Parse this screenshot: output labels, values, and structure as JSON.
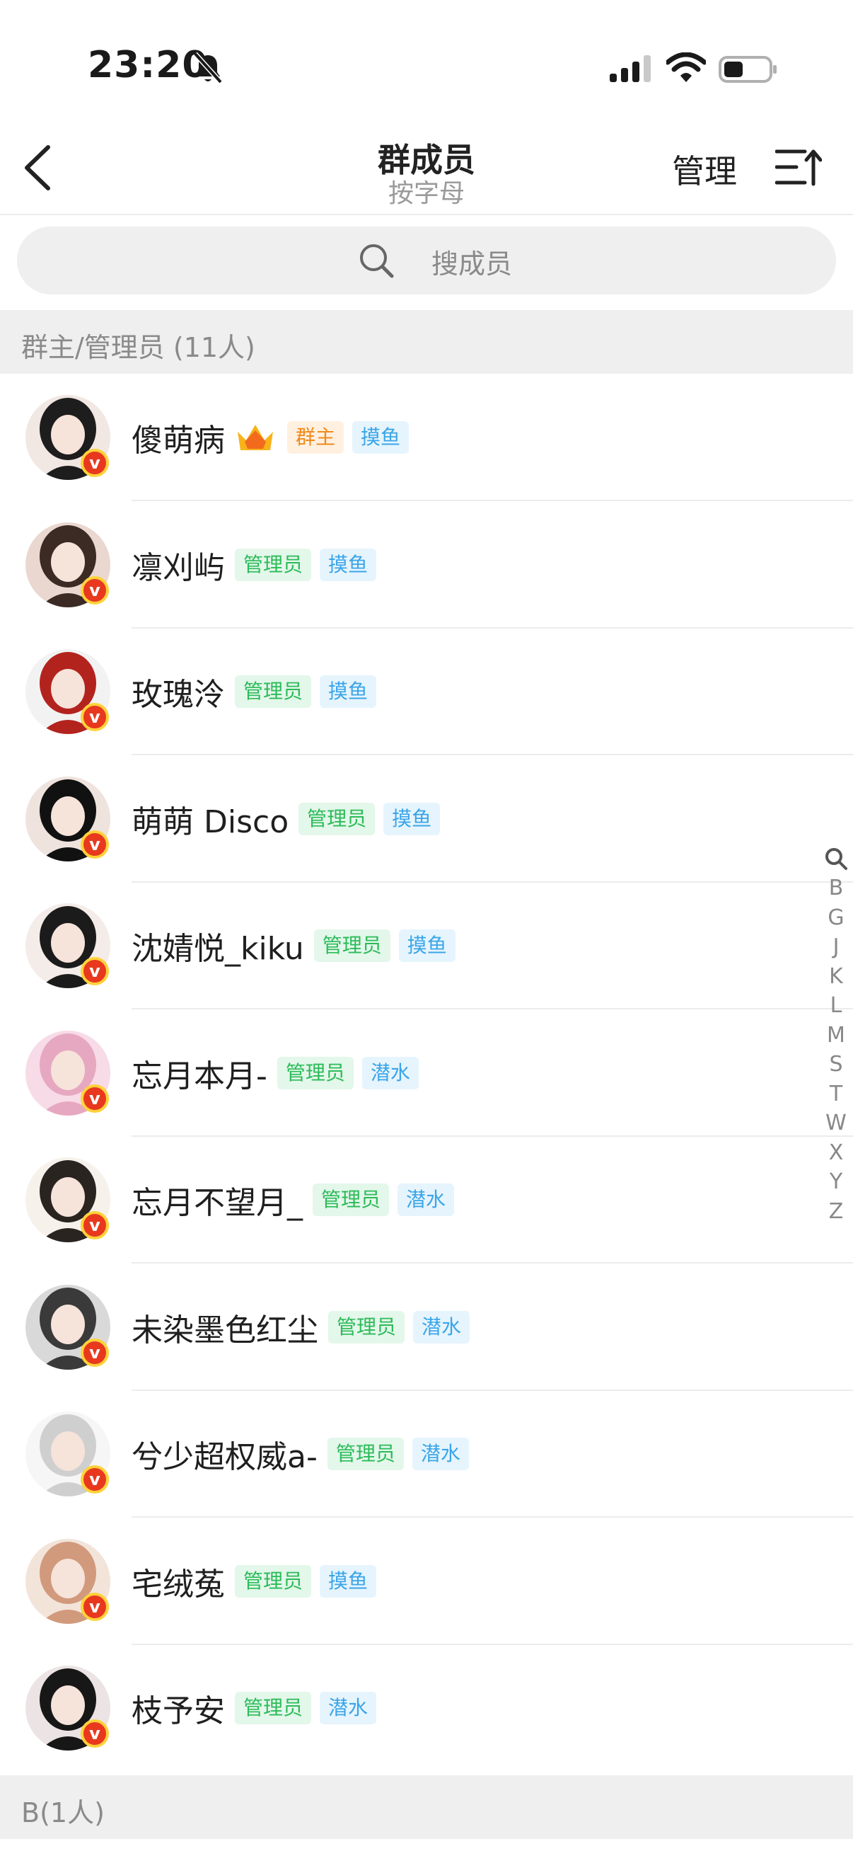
{
  "status_bar": {
    "time": "23:20"
  },
  "header": {
    "title": "群成员",
    "subtitle": "按字母",
    "manage_label": "管理"
  },
  "search": {
    "placeholder": "搜成员"
  },
  "sections": [
    {
      "title": "群主/管理员 (11人)"
    },
    {
      "title": "B(1人)"
    }
  ],
  "members": [
    {
      "name": "傻萌病",
      "crown": true,
      "tags": [
        {
          "text": "群主",
          "kind": "owner"
        },
        {
          "text": "摸鱼",
          "kind": "level"
        }
      ],
      "avatar_colors": [
        "#f1e7e3",
        "#1d1d1d"
      ]
    },
    {
      "name": "凛刈屿",
      "crown": false,
      "tags": [
        {
          "text": "管理员",
          "kind": "admin"
        },
        {
          "text": "摸鱼",
          "kind": "level"
        }
      ],
      "avatar_colors": [
        "#ead7cf",
        "#3b2b24"
      ]
    },
    {
      "name": "玫瑰泠",
      "crown": false,
      "tags": [
        {
          "text": "管理员",
          "kind": "admin"
        },
        {
          "text": "摸鱼",
          "kind": "level"
        }
      ],
      "avatar_colors": [
        "#f2f2f2",
        "#b3231e"
      ]
    },
    {
      "name": "萌萌 Disco",
      "crown": false,
      "tags": [
        {
          "text": "管理员",
          "kind": "admin"
        },
        {
          "text": "摸鱼",
          "kind": "level"
        }
      ],
      "avatar_colors": [
        "#efe3de",
        "#111111"
      ]
    },
    {
      "name": "沈婧悦_kiku",
      "crown": false,
      "tags": [
        {
          "text": "管理员",
          "kind": "admin"
        },
        {
          "text": "摸鱼",
          "kind": "level"
        }
      ],
      "avatar_colors": [
        "#f4ece8",
        "#1b1b1b"
      ]
    },
    {
      "name": "忘月本月-",
      "crown": false,
      "tags": [
        {
          "text": "管理员",
          "kind": "admin"
        },
        {
          "text": "潜水",
          "kind": "level"
        }
      ],
      "avatar_colors": [
        "#f7dbe6",
        "#e6a8c0"
      ]
    },
    {
      "name": "忘月不望月_",
      "crown": false,
      "tags": [
        {
          "text": "管理员",
          "kind": "admin"
        },
        {
          "text": "潜水",
          "kind": "level"
        }
      ],
      "avatar_colors": [
        "#f6f1ea",
        "#2a2421"
      ]
    },
    {
      "name": "未染墨色红尘",
      "crown": false,
      "tags": [
        {
          "text": "管理员",
          "kind": "admin"
        },
        {
          "text": "潜水",
          "kind": "level"
        }
      ],
      "avatar_colors": [
        "#d9d9d9",
        "#3a3a3a"
      ]
    },
    {
      "name": "兮少超权威a-",
      "crown": false,
      "tags": [
        {
          "text": "管理员",
          "kind": "admin"
        },
        {
          "text": "潜水",
          "kind": "level"
        }
      ],
      "avatar_colors": [
        "#f6f6f6",
        "#cfcfcf"
      ]
    },
    {
      "name": "宅绒菟",
      "crown": false,
      "tags": [
        {
          "text": "管理员",
          "kind": "admin"
        },
        {
          "text": "摸鱼",
          "kind": "level"
        }
      ],
      "avatar_colors": [
        "#f3e4da",
        "#d19a7d"
      ]
    },
    {
      "name": "枝予安",
      "crown": false,
      "tags": [
        {
          "text": "管理员",
          "kind": "admin"
        },
        {
          "text": "潜水",
          "kind": "level"
        }
      ],
      "avatar_colors": [
        "#ece4e4",
        "#171717"
      ]
    }
  ],
  "index_letters": [
    "B",
    "G",
    "J",
    "K",
    "L",
    "M",
    "S",
    "T",
    "W",
    "X",
    "Y",
    "Z"
  ],
  "colors": {
    "admin_tag": "#2cbb59",
    "level_tag": "#3aa5e8",
    "owner_tag": "#f08a1c",
    "badge": "#e8391e"
  }
}
